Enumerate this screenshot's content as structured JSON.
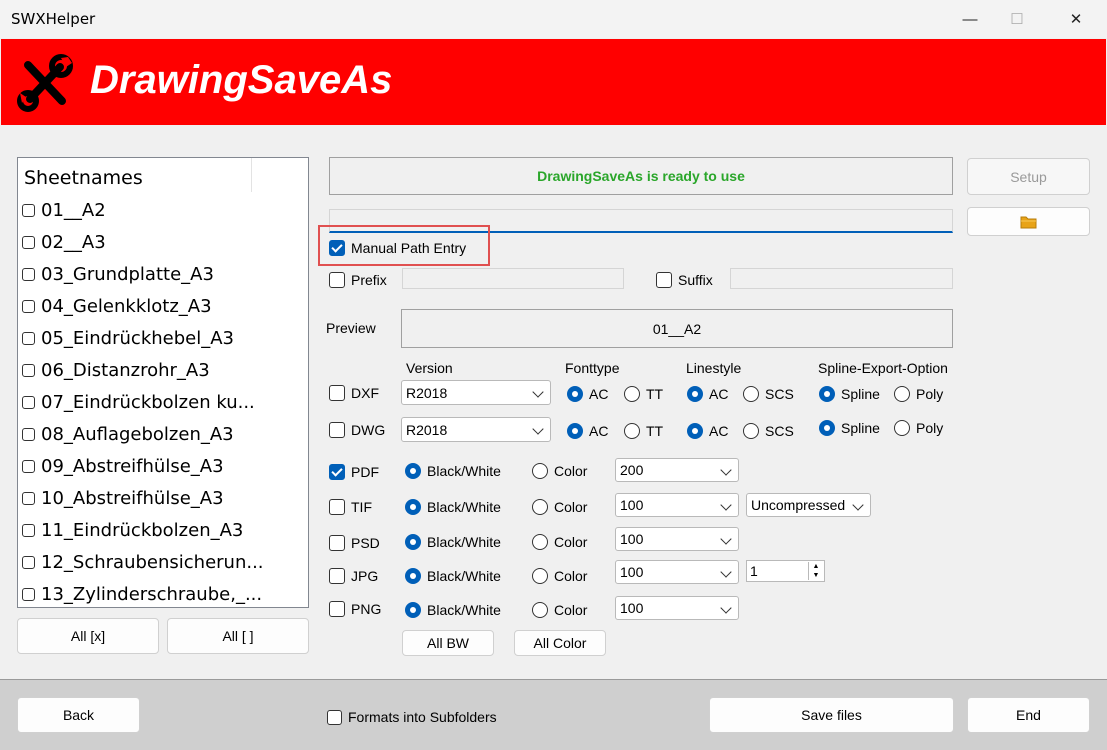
{
  "app": {
    "title": "SWXHelper",
    "banner_title": "DrawingSaveAs"
  },
  "window_controls": {
    "minimize": "—",
    "maximize": "☐",
    "close": "✕"
  },
  "sheets": {
    "header": "Sheetnames",
    "items": [
      "01__A2",
      "02__A3",
      "03_Grundplatte_A3",
      "04_Gelenkklotz_A3",
      "05_Eindrückhebel_A3",
      "06_Distanzrohr_A3",
      "07_Eindrückbolzen ku...",
      "08_Auflagebolzen_A3",
      "09_Abstreifhülse_A3",
      "10_Abstreifhülse_A3",
      "11_Eindrückbolzen_A3",
      "12_Schraubensicherun...",
      "13_Zylinderschraube,_..."
    ],
    "select_all": "All [x]",
    "select_none": "All [ ]"
  },
  "status": {
    "text": "DrawingSaveAs is ready to use",
    "color": "#2aa62a"
  },
  "setup_button": "Setup",
  "folder_icon": "folder-icon",
  "path_input": "",
  "manual_path": {
    "label": "Manual Path Entry",
    "checked": true
  },
  "prefix": {
    "label": "Prefix",
    "value": ""
  },
  "suffix": {
    "label": "Suffix",
    "value": ""
  },
  "preview": {
    "label": "Preview",
    "value": "01__A2"
  },
  "columns": {
    "version": "Version",
    "fonttype": "Fonttype",
    "linestyle": "Linestyle",
    "spline": "Spline-Export-Option"
  },
  "cad_formats": [
    {
      "label": "DXF",
      "version": "R2018",
      "font_ac": "AC",
      "font_tt": "TT",
      "line_ac": "AC",
      "line_scs": "SCS",
      "spline": "Spline",
      "poly": "Poly"
    },
    {
      "label": "DWG",
      "version": "R2018",
      "font_ac": "AC",
      "font_tt": "TT",
      "line_ac": "AC",
      "line_scs": "SCS",
      "spline": "Spline",
      "poly": "Poly"
    }
  ],
  "image_formats": [
    {
      "label": "PDF",
      "checked": true,
      "bw": "Black/White",
      "color": "Color",
      "dpi": "200"
    },
    {
      "label": "TIF",
      "checked": false,
      "bw": "Black/White",
      "color": "Color",
      "dpi": "100",
      "compression": "Uncompressed"
    },
    {
      "label": "PSD",
      "checked": false,
      "bw": "Black/White",
      "color": "Color",
      "dpi": "100"
    },
    {
      "label": "JPG",
      "checked": false,
      "bw": "Black/White",
      "color": "Color",
      "dpi": "100",
      "quality": "1"
    },
    {
      "label": "PNG",
      "checked": false,
      "bw": "Black/White",
      "color": "Color",
      "dpi": "100"
    }
  ],
  "all_bw": "All BW",
  "all_color": "All Color",
  "footer": {
    "back": "Back",
    "subfolders": "Formats into Subfolders",
    "save": "Save files",
    "end": "End"
  },
  "colors": {
    "banner": "#ff0000",
    "accent": "#005fb8",
    "highlight_box": "#e05050"
  }
}
